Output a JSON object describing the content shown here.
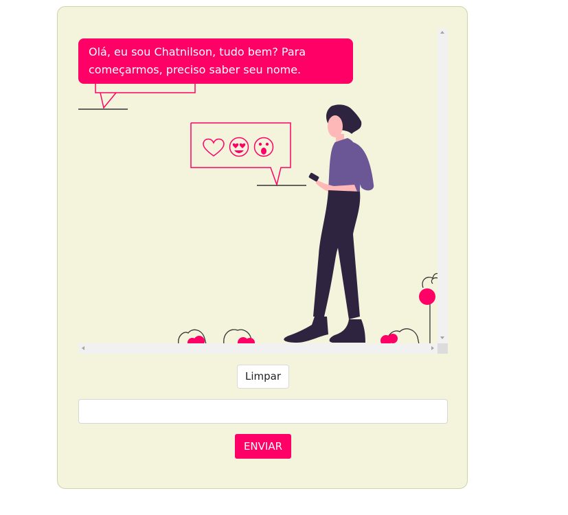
{
  "chat": {
    "messages": [
      {
        "sender": "bot",
        "text": "Olá, eu sou Chatnilson, tudo bem? Para começarmos, preciso saber seu nome."
      }
    ]
  },
  "controls": {
    "clear_label": "Limpar",
    "input_value": "",
    "input_placeholder": "",
    "send_label": "ENVIAR"
  },
  "icons": {
    "speech_icons": [
      "heart-icon",
      "heart-eyes-emoji-icon",
      "surprised-emoji-icon"
    ]
  },
  "colors": {
    "accent": "#ff0066",
    "card_background": "#f4f4dc",
    "figure_top": "#6b5796",
    "figure_pants": "#2f2440"
  }
}
